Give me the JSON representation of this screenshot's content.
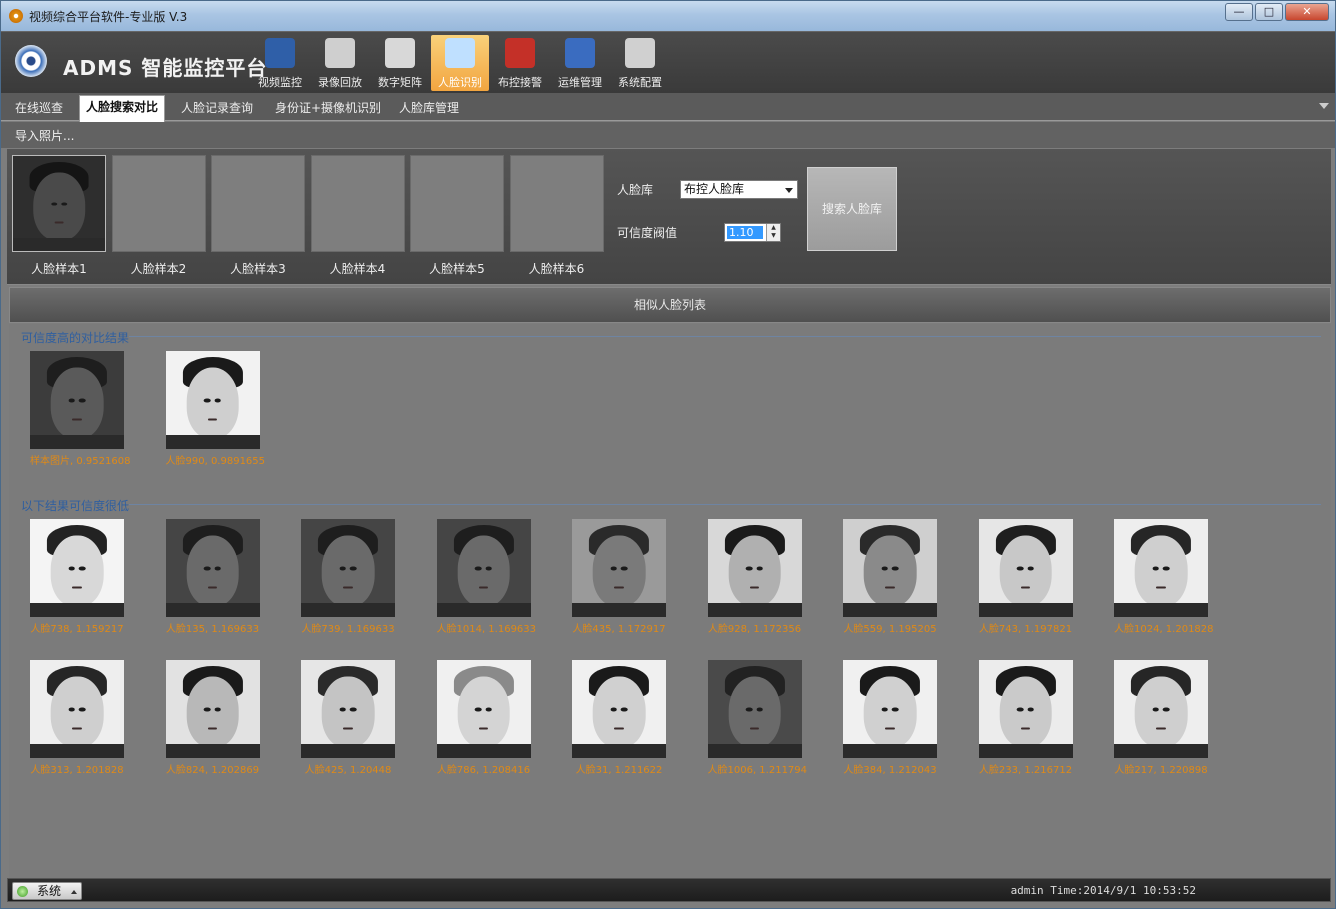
{
  "window": {
    "title": "视频综合平台软件-专业版   V.3",
    "controls": {
      "minimize": "—",
      "maximize": "□",
      "close": "✕"
    }
  },
  "header": {
    "brand": "ADMS 智能监控平台",
    "tools": [
      {
        "label": "视频监控",
        "icon": "camera-eye-icon",
        "active": false
      },
      {
        "label": "录像回放",
        "icon": "clapperboard-icon",
        "active": false
      },
      {
        "label": "数字矩阵",
        "icon": "grid-matrix-icon",
        "active": false
      },
      {
        "label": "人脸识别",
        "icon": "face-id-icon",
        "active": true
      },
      {
        "label": "布控接警",
        "icon": "alarm-light-icon",
        "active": false
      },
      {
        "label": "运维管理",
        "icon": "technician-icon",
        "active": false
      },
      {
        "label": "系统配置",
        "icon": "gear-icon",
        "active": false
      }
    ]
  },
  "tabs": [
    {
      "label": "在线巡查",
      "active": false
    },
    {
      "label": "人脸搜索对比",
      "active": true
    },
    {
      "label": "人脸记录查询",
      "active": false
    },
    {
      "label": "身份证+摄像机识别",
      "active": false
    },
    {
      "label": "人脸库管理",
      "active": false
    }
  ],
  "import_link": "导入照片...",
  "samples": [
    {
      "label": "人脸样本1",
      "has_photo": true
    },
    {
      "label": "人脸样本2",
      "has_photo": false
    },
    {
      "label": "人脸样本3",
      "has_photo": false
    },
    {
      "label": "人脸样本4",
      "has_photo": false
    },
    {
      "label": "人脸样本5",
      "has_photo": false
    },
    {
      "label": "人脸样本6",
      "has_photo": false
    }
  ],
  "controls": {
    "face_db_label": "人脸库",
    "face_db_value": "布控人脸库",
    "threshold_label": "可信度阀值",
    "threshold_value": "1.10",
    "search_button": "搜索人脸库"
  },
  "list_header": "相似人脸列表",
  "high_section_title": "可信度高的对比结果",
  "high_results": [
    {
      "caption": "样本图片, 0.9521608",
      "skin": "#5a5a5a",
      "hair": "#1e1e1e",
      "bg": "#3c3c3c"
    },
    {
      "caption": "人脸990, 0.9891655",
      "skin": "#cfcfcf",
      "hair": "#1a1a1a",
      "bg": "#f2f2f2"
    }
  ],
  "low_section_title": "以下结果可信度很低",
  "low_results": [
    {
      "caption": "人脸738, 1.159217",
      "skin": "#d8d8d8",
      "hair": "#222",
      "bg": "#f4f4f4"
    },
    {
      "caption": "人脸135, 1.169633",
      "skin": "#6a6a6a",
      "hair": "#1e1e1e",
      "bg": "#454545"
    },
    {
      "caption": "人脸739, 1.169633",
      "skin": "#6a6a6a",
      "hair": "#1e1e1e",
      "bg": "#454545"
    },
    {
      "caption": "人脸1014, 1.169633",
      "skin": "#6a6a6a",
      "hair": "#1e1e1e",
      "bg": "#454545"
    },
    {
      "caption": "人脸435, 1.172917",
      "skin": "#7a7a7a",
      "hair": "#2a2a2a",
      "bg": "#9a9a9a"
    },
    {
      "caption": "人脸928, 1.172356",
      "skin": "#b0b0b0",
      "hair": "#1a1a1a",
      "bg": "#d8d8d8"
    },
    {
      "caption": "人脸559, 1.195205",
      "skin": "#8a8a8a",
      "hair": "#2a2a2a",
      "bg": "#cfcfcf"
    },
    {
      "caption": "人脸743, 1.197821",
      "skin": "#c8c8c8",
      "hair": "#1e1e1e",
      "bg": "#e6e6e6"
    },
    {
      "caption": "人脸1024, 1.201828",
      "skin": "#cfcfcf",
      "hair": "#262626",
      "bg": "#eeeeee"
    },
    {
      "caption": "人脸313, 1.201828",
      "skin": "#cfcfcf",
      "hair": "#262626",
      "bg": "#eeeeee"
    },
    {
      "caption": "人脸824, 1.202869",
      "skin": "#b8b8b8",
      "hair": "#1a1a1a",
      "bg": "#e2e2e2"
    },
    {
      "caption": "人脸425, 1.20448",
      "skin": "#c4c4c4",
      "hair": "#2a2a2a",
      "bg": "#e6e6e6"
    },
    {
      "caption": "人脸786, 1.208416",
      "skin": "#d4d4d4",
      "hair": "#8a8a8a",
      "bg": "#f0f0f0"
    },
    {
      "caption": "人脸31, 1.211622",
      "skin": "#d0d0d0",
      "hair": "#1a1a1a",
      "bg": "#f0f0f0"
    },
    {
      "caption": "人脸1006, 1.211794",
      "skin": "#6a6a6a",
      "hair": "#222",
      "bg": "#4a4a4a"
    },
    {
      "caption": "人脸384, 1.212043",
      "skin": "#d0d0d0",
      "hair": "#1a1a1a",
      "bg": "#f0f0f0"
    },
    {
      "caption": "人脸233, 1.216712",
      "skin": "#cacaca",
      "hair": "#1a1a1a",
      "bg": "#ececec"
    },
    {
      "caption": "人脸217, 1.220898",
      "skin": "#cfcfcf",
      "hair": "#262626",
      "bg": "#eeeeee"
    }
  ],
  "status": {
    "system_button": "系统",
    "info": "admin  Time:2014/9/1 10:53:52"
  }
}
